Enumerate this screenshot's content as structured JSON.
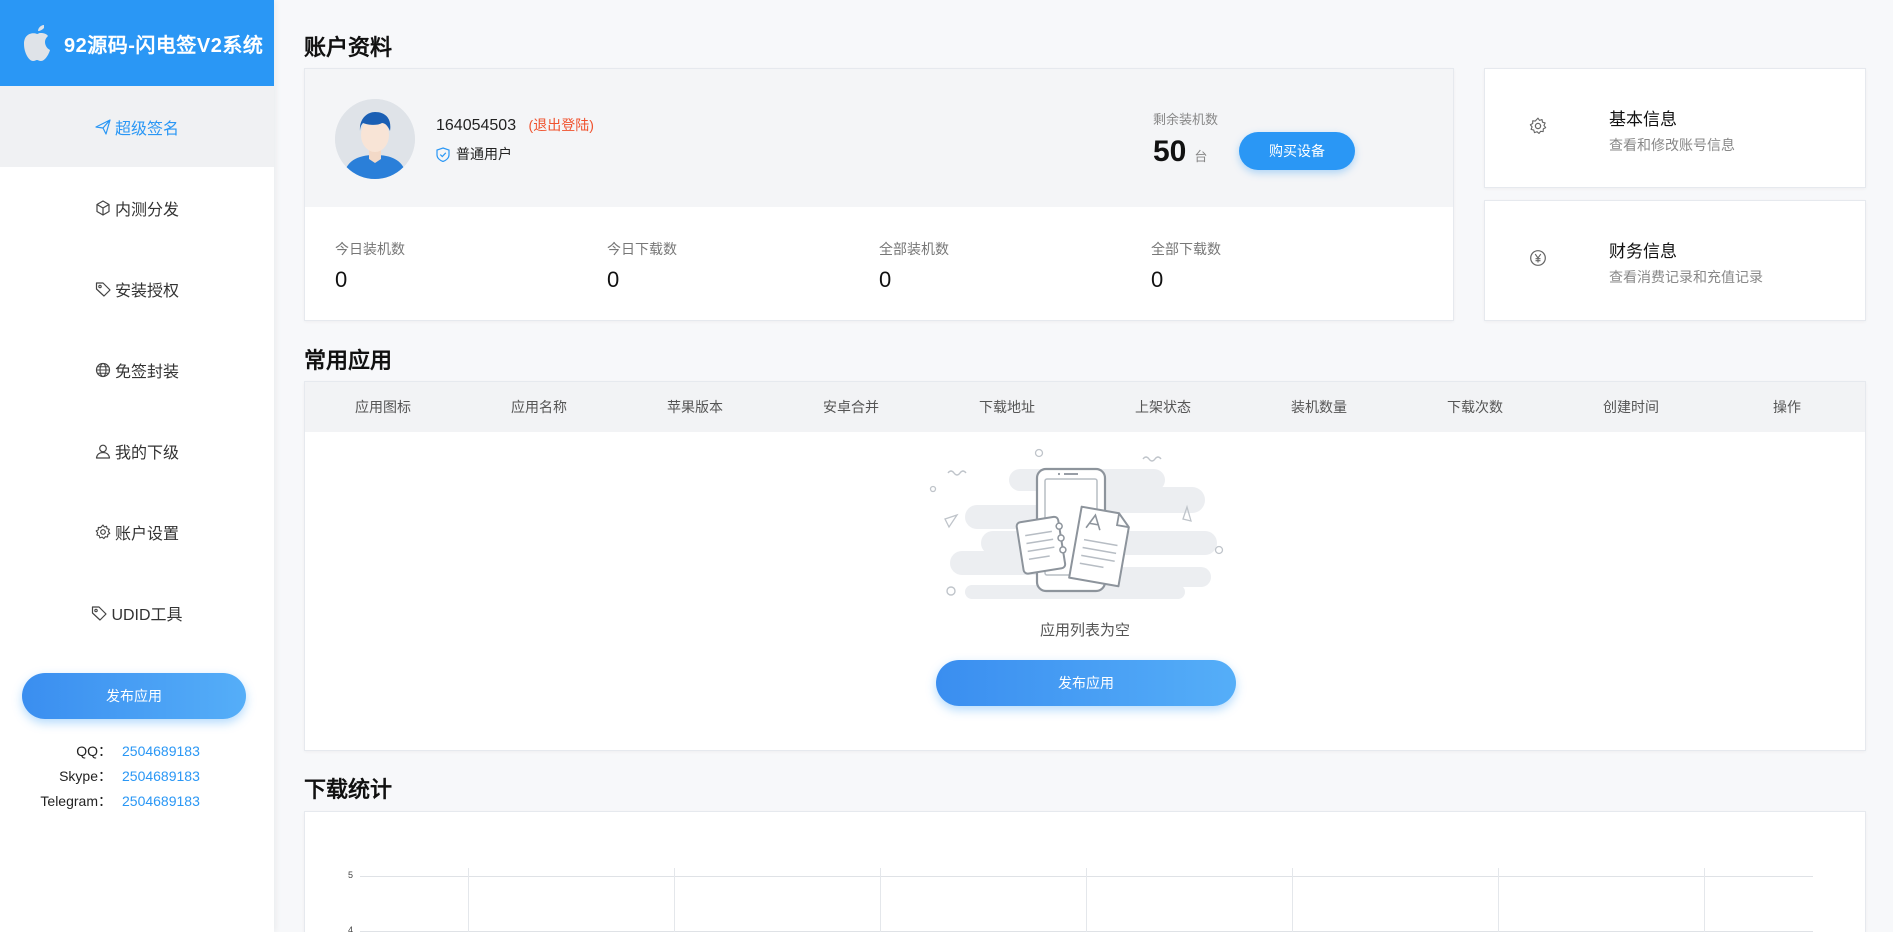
{
  "brand": {
    "title": "92源码-闪电签V2系统"
  },
  "sidebar": {
    "items": [
      {
        "label": "超级签名",
        "icon": "paper-plane-icon"
      },
      {
        "label": "内测分发",
        "icon": "cube-icon"
      },
      {
        "label": "安装授权",
        "icon": "tag-icon"
      },
      {
        "label": "免签封装",
        "icon": "globe-icon"
      },
      {
        "label": "我的下级",
        "icon": "user-icon"
      },
      {
        "label": "账户设置",
        "icon": "gear-icon"
      },
      {
        "label": "UDID工具",
        "icon": "tag-icon"
      }
    ],
    "publish_label": "发布应用",
    "contacts": [
      {
        "key": "QQ：",
        "value": "2504689183"
      },
      {
        "key": "Skype：",
        "value": "2504689183"
      },
      {
        "key": "Telegram：",
        "value": "2504689183"
      }
    ]
  },
  "account": {
    "section_title": "账户资料",
    "user_id": "164054503",
    "logout_label": "(退出登陆)",
    "role": "普通用户",
    "remaining_label": "剩余装机数",
    "remaining_value": "50",
    "remaining_unit": "台",
    "buy_label": "购买设备",
    "stats": [
      {
        "label": "今日装机数",
        "value": "0"
      },
      {
        "label": "今日下载数",
        "value": "0"
      },
      {
        "label": "全部装机数",
        "value": "0"
      },
      {
        "label": "全部下载数",
        "value": "0"
      }
    ]
  },
  "info_cards": [
    {
      "title": "基本信息",
      "desc": "查看和修改账号信息",
      "icon": "gear-icon"
    },
    {
      "title": "财务信息",
      "desc": "查看消费记录和充值记录",
      "icon": "yen-icon"
    }
  ],
  "apps": {
    "section_title": "常用应用",
    "columns": [
      "应用图标",
      "应用名称",
      "苹果版本",
      "安卓合并",
      "下载地址",
      "上架状态",
      "装机数量",
      "下载次数",
      "创建时间",
      "操作"
    ],
    "empty_text": "应用列表为空",
    "publish_label": "发布应用"
  },
  "downloads": {
    "section_title": "下载统计",
    "y_ticks": [
      "5",
      "4"
    ]
  },
  "colors": {
    "primary": "#2a97f5",
    "danger": "#f0522e"
  }
}
